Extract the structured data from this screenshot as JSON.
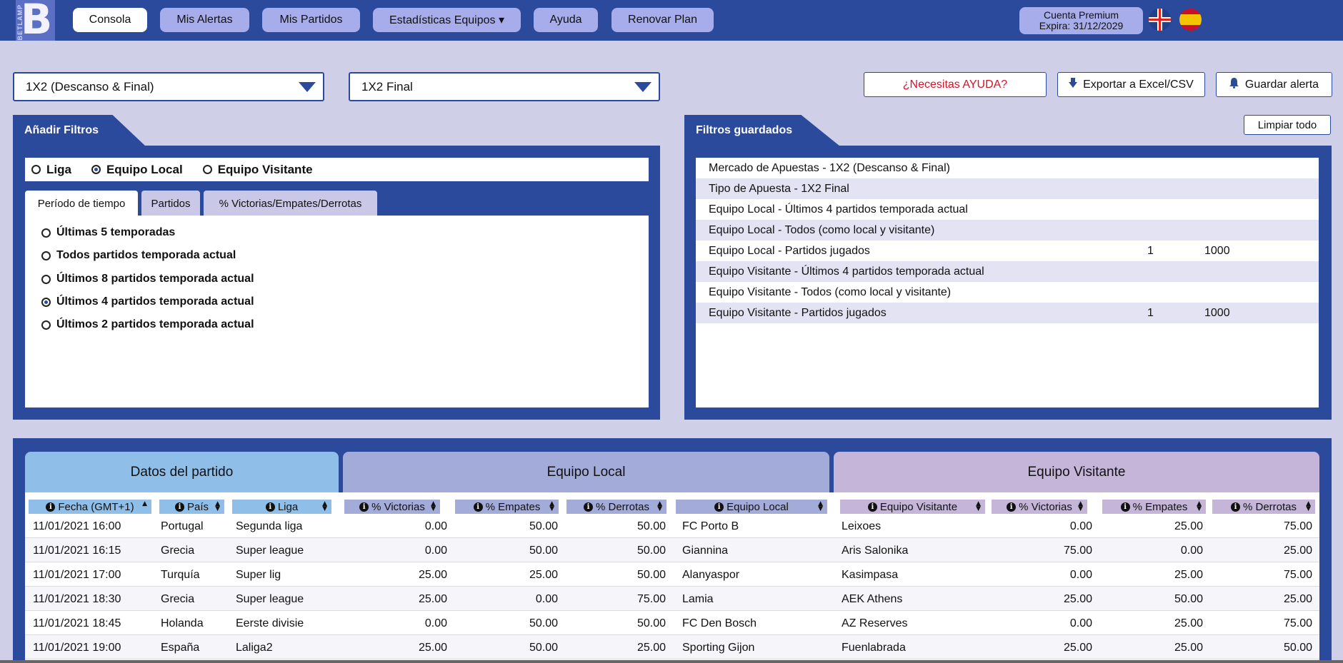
{
  "brand": {
    "letter": "B",
    "name": "BETLAMP"
  },
  "nav": [
    {
      "label": "Consola",
      "active": true
    },
    {
      "label": "Mis Alertas"
    },
    {
      "label": "Mis Partidos"
    },
    {
      "label": "Estadísticas Equipos ▾"
    },
    {
      "label": "Ayuda"
    },
    {
      "label": "Renovar Plan"
    }
  ],
  "account": {
    "line1": "Cuenta Premium",
    "line2": "Expira: 31/12/2029"
  },
  "selects": {
    "market": "1X2 (Descanso & Final)",
    "bet_type": "1X2 Final"
  },
  "actions": {
    "help": "¿Necesitas AYUDA?",
    "export": "Exportar a Excel/CSV",
    "save": "Guardar alerta",
    "clear": "Limpiar todo"
  },
  "add_filters": {
    "title": "Añadir Filtros",
    "scope": [
      "Liga",
      "Equipo Local",
      "Equipo Visitante"
    ],
    "scope_selected": "Equipo Local",
    "tabs": [
      "Período de tiempo",
      "Partidos",
      "% Victorias/Empates/Derrotas"
    ],
    "active_tab": "Período de tiempo",
    "periods": [
      "Últimas 5 temporadas",
      "Todos partidos temporada actual",
      "Últimos 8 partidos temporada actual",
      "Últimos 4 partidos temporada actual",
      "Últimos 2 partidos temporada actual"
    ],
    "period_selected": "Últimos 4 partidos temporada actual"
  },
  "saved_filters": {
    "title": "Filtros guardados",
    "rows": [
      {
        "text": "Mercado de Apuestas - 1X2 (Descanso & Final)",
        "v1": "",
        "v2": ""
      },
      {
        "text": "Tipo de Apuesta - 1X2 Final",
        "v1": "",
        "v2": ""
      },
      {
        "text": "Equipo Local - Últimos 4 partidos temporada actual",
        "v1": "",
        "v2": ""
      },
      {
        "text": "Equipo Local - Todos (como local y visitante)",
        "v1": "",
        "v2": ""
      },
      {
        "text": "Equipo Local - Partidos jugados",
        "v1": "1",
        "v2": "1000"
      },
      {
        "text": "Equipo Visitante - Últimos 4 partidos temporada actual",
        "v1": "",
        "v2": ""
      },
      {
        "text": "Equipo Visitante - Todos (como local y visitante)",
        "v1": "",
        "v2": ""
      },
      {
        "text": "Equipo Visitante - Partidos jugados",
        "v1": "1",
        "v2": "1000"
      }
    ]
  },
  "table": {
    "groups": [
      "Datos del partido",
      "Equipo Local",
      "Equipo Visitante"
    ],
    "columns": [
      "Fecha (GMT+1)",
      "País",
      "Liga",
      "% Victorias",
      "% Empates",
      "% Derrotas",
      "Equipo Local",
      "Equipo Visitante",
      "% Victorias",
      "% Empates",
      "% Derrotas"
    ],
    "rows": [
      [
        "11/01/2021 16:00",
        "Portugal",
        "Segunda liga",
        "0.00",
        "50.00",
        "50.00",
        "FC Porto B",
        "Leixoes",
        "0.00",
        "25.00",
        "75.00"
      ],
      [
        "11/01/2021 16:15",
        "Grecia",
        "Super league",
        "0.00",
        "50.00",
        "50.00",
        "Giannina",
        "Aris Salonika",
        "75.00",
        "0.00",
        "25.00"
      ],
      [
        "11/01/2021 17:00",
        "Turquía",
        "Super lig",
        "25.00",
        "25.00",
        "50.00",
        "Alanyaspor",
        "Kasimpasa",
        "0.00",
        "25.00",
        "75.00"
      ],
      [
        "11/01/2021 18:30",
        "Grecia",
        "Super league",
        "25.00",
        "0.00",
        "75.00",
        "Lamia",
        "AEK Athens",
        "25.00",
        "50.00",
        "25.00"
      ],
      [
        "11/01/2021 18:45",
        "Holanda",
        "Eerste divisie",
        "0.00",
        "50.00",
        "50.00",
        "FC Den Bosch",
        "AZ Reserves",
        "0.00",
        "25.00",
        "75.00"
      ],
      [
        "11/01/2021 19:00",
        "España",
        "Laliga2",
        "25.00",
        "50.00",
        "25.00",
        "Sporting Gijon",
        "Fuenlabrada",
        "25.00",
        "25.00",
        "50.00"
      ]
    ]
  },
  "colors": {
    "primary": "#2b4a9c",
    "background": "#d0cfe8",
    "nav_button": "#a7aceb",
    "group_match": "#8fbfe8",
    "group_home": "#a3abd9",
    "group_away": "#c5b5d9",
    "help_text": "#d0142a"
  }
}
